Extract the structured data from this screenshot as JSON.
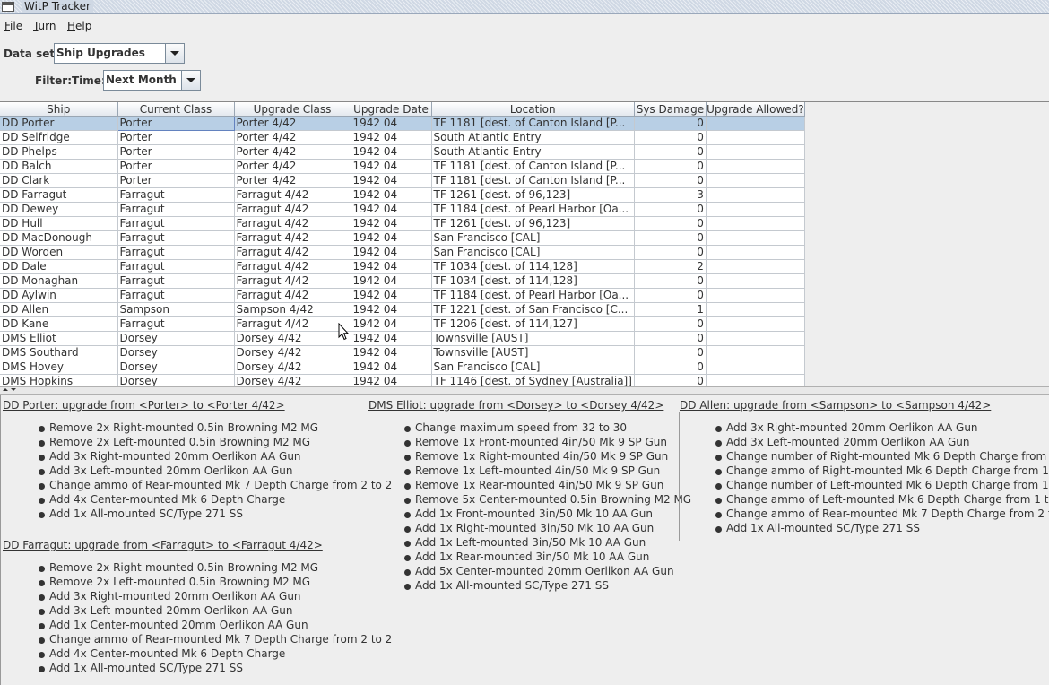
{
  "window": {
    "title": "WitP Tracker"
  },
  "menu": [
    {
      "label": "File"
    },
    {
      "label": "Turn"
    },
    {
      "label": "Help"
    }
  ],
  "dataset": {
    "label": "Data set:",
    "value": "Ship Upgrades"
  },
  "filter": {
    "label": "Filter:",
    "time_label": "Time:",
    "time_value": "Next Month"
  },
  "table": {
    "columns": [
      "Ship",
      "Current Class",
      "Upgrade Class",
      "Upgrade Date",
      "Location",
      "Sys Damage",
      "Upgrade Allowed?"
    ],
    "rows": [
      [
        "DD Porter",
        "Porter",
        "Porter 4/42",
        "1942 04",
        "TF 1181 [dest. of Canton Island [P...",
        "0",
        ""
      ],
      [
        "DD Selfridge",
        "Porter",
        "Porter 4/42",
        "1942 04",
        "South Atlantic Entry",
        "0",
        ""
      ],
      [
        "DD Phelps",
        "Porter",
        "Porter 4/42",
        "1942 04",
        "South Atlantic Entry",
        "0",
        ""
      ],
      [
        "DD Balch",
        "Porter",
        "Porter 4/42",
        "1942 04",
        "TF 1181 [dest. of Canton Island [P...",
        "0",
        ""
      ],
      [
        "DD Clark",
        "Porter",
        "Porter 4/42",
        "1942 04",
        "TF 1181 [dest. of Canton Island [P...",
        "0",
        ""
      ],
      [
        "DD Farragut",
        "Farragut",
        "Farragut 4/42",
        "1942 04",
        "TF 1261 [dest. of 96,123]",
        "3",
        ""
      ],
      [
        "DD Dewey",
        "Farragut",
        "Farragut 4/42",
        "1942 04",
        "TF 1184 [dest. of Pearl Harbor [Oa...",
        "0",
        ""
      ],
      [
        "DD Hull",
        "Farragut",
        "Farragut 4/42",
        "1942 04",
        "TF 1261 [dest. of 96,123]",
        "0",
        ""
      ],
      [
        "DD MacDonough",
        "Farragut",
        "Farragut 4/42",
        "1942 04",
        "San Francisco [CAL]",
        "0",
        ""
      ],
      [
        "DD Worden",
        "Farragut",
        "Farragut 4/42",
        "1942 04",
        "San Francisco [CAL]",
        "0",
        ""
      ],
      [
        "DD Dale",
        "Farragut",
        "Farragut 4/42",
        "1942 04",
        "TF 1034 [dest. of 114,128]",
        "2",
        ""
      ],
      [
        "DD Monaghan",
        "Farragut",
        "Farragut 4/42",
        "1942 04",
        "TF 1034 [dest. of 114,128]",
        "0",
        ""
      ],
      [
        "DD Aylwin",
        "Farragut",
        "Farragut 4/42",
        "1942 04",
        "TF 1184 [dest. of Pearl Harbor [Oa...",
        "0",
        ""
      ],
      [
        "DD Allen",
        "Sampson",
        "Sampson 4/42",
        "1942 04",
        "TF 1221 [dest. of San Francisco [C...",
        "1",
        ""
      ],
      [
        "DD Kane",
        "Farragut",
        "Farragut 4/42",
        "1942 04",
        "TF 1206 [dest. of 114,127]",
        "0",
        ""
      ],
      [
        "DMS Elliot",
        "Dorsey",
        "Dorsey 4/42",
        "1942 04",
        "Townsville [AUST]",
        "0",
        ""
      ],
      [
        "DMS Southard",
        "Dorsey",
        "Dorsey 4/42",
        "1942 04",
        "Townsville [AUST]",
        "0",
        ""
      ],
      [
        "DMS Hovey",
        "Dorsey",
        "Dorsey 4/42",
        "1942 04",
        "San Francisco [CAL]",
        "0",
        ""
      ],
      [
        "DMS Hopkins",
        "Dorsey",
        "Dorsey 4/42",
        "1942 04",
        "TF 1146 [dest. of Sydney [Australia]]",
        "0",
        ""
      ]
    ]
  },
  "details": [
    {
      "title": "DD Porter: upgrade from <Porter> to <Porter 4/42>",
      "items": [
        "Remove 2x Right-mounted 0.5in Browning M2 MG",
        "Remove 2x Left-mounted 0.5in Browning M2 MG",
        "Add 3x Right-mounted 20mm Oerlikon AA Gun",
        "Add 3x Left-mounted 20mm Oerlikon AA Gun",
        "Change ammo of Rear-mounted Mk 7 Depth Charge from 2 to 2",
        "Add 4x Center-mounted Mk 6 Depth Charge",
        "Add 1x All-mounted SC/Type 271 SS"
      ]
    },
    {
      "title": "DMS Elliot: upgrade from <Dorsey> to <Dorsey 4/42>",
      "items": [
        "Change maximum speed from 32 to 30",
        "Remove 1x Front-mounted 4in/50 Mk 9 SP Gun",
        "Remove 1x Right-mounted 4in/50 Mk 9 SP Gun",
        "Remove 1x Left-mounted 4in/50 Mk 9 SP Gun",
        "Remove 1x Rear-mounted 4in/50 Mk 9 SP Gun",
        "Remove 5x Center-mounted 0.5in Browning M2 MG",
        "Add 1x Front-mounted 3in/50 Mk 10 AA Gun",
        "Add 1x Right-mounted 3in/50 Mk 10 AA Gun",
        "Add 1x Left-mounted 3in/50 Mk 10 AA Gun",
        "Add 1x Rear-mounted 3in/50 Mk 10 AA Gun",
        "Add 5x Center-mounted 20mm Oerlikon AA Gun",
        "Add 1x All-mounted SC/Type 271 SS"
      ]
    },
    {
      "title": "DD Allen: upgrade from <Sampson> to <Sampson 4/42>",
      "items": [
        "Add 3x Right-mounted 20mm Oerlikon AA Gun",
        "Add 3x Left-mounted 20mm Oerlikon AA Gun",
        "Change number of Right-mounted Mk 6 Depth Charge from 1 to 3",
        "Change ammo of Right-mounted Mk 6 Depth Charge from 1 to 3",
        "Change number of Left-mounted Mk 6 Depth Charge from 1 to 3",
        "Change ammo of Left-mounted Mk 6 Depth Charge from 1 to 3",
        "Change ammo of Rear-mounted Mk 7 Depth Charge from 2 to 2",
        "Add 1x All-mounted SC/Type 271 SS"
      ]
    },
    {
      "title": "DD Farragut: upgrade from <Farragut> to <Farragut 4/42>",
      "items": [
        "Remove 2x Right-mounted 0.5in Browning M2 MG",
        "Remove 2x Left-mounted 0.5in Browning M2 MG",
        "Add 3x Right-mounted 20mm Oerlikon AA Gun",
        "Add 3x Left-mounted 20mm Oerlikon AA Gun",
        "Add 1x Center-mounted 20mm Oerlikon AA Gun",
        "Change ammo of Rear-mounted Mk 7 Depth Charge from 2 to 2",
        "Add 4x Center-mounted Mk 6 Depth Charge",
        "Add 1x All-mounted SC/Type 271 SS"
      ]
    }
  ],
  "icons": {
    "window": "window-icon",
    "dropdown": "chevron-down-icon",
    "pointer": "mouse-pointer-icon"
  },
  "colors": {
    "selection": "#b8cfe5",
    "titlebar": "#cfd8e4"
  }
}
